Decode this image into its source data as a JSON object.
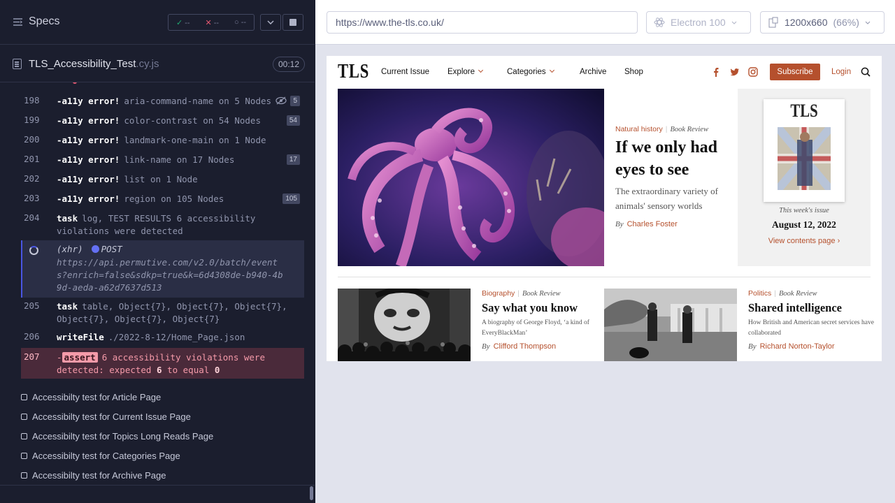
{
  "reporter": {
    "header": {
      "specs_label": "Specs",
      "passed": "--",
      "failed": "--",
      "pending": "--"
    },
    "spec": {
      "name": "TLS_Accessibility_Test",
      "ext": ".cy.js",
      "time": "00:12"
    },
    "commands": [
      {
        "num": "198",
        "kw": "-a11y error!",
        "msg": "aria-command-name on 5 Nodes",
        "badge": "5"
      },
      {
        "num": "199",
        "kw": "-a11y error!",
        "msg": "color-contrast on 54 Nodes",
        "badge": "54"
      },
      {
        "num": "200",
        "kw": "-a11y error!",
        "msg": "landmark-one-main on 1 Node",
        "badge": ""
      },
      {
        "num": "201",
        "kw": "-a11y error!",
        "msg": "link-name on 17 Nodes",
        "badge": "17"
      },
      {
        "num": "202",
        "kw": "-a11y error!",
        "msg": "list on 1 Node",
        "badge": ""
      },
      {
        "num": "203",
        "kw": "-a11y error!",
        "msg": "region on 105 Nodes",
        "badge": "105"
      },
      {
        "num": "204",
        "kw": "task",
        "msg": "log, TEST RESULTS 6 accessibility violations were detected",
        "badge": ""
      },
      {
        "num": "205",
        "kw": "task",
        "msg": "table, Object{7}, Object{7}, Object{7}, Object{7}, Object{7}, Object{7}",
        "badge": ""
      },
      {
        "num": "206",
        "kw": "writeFile",
        "msg": "./2022-8-12/Home_Page.json",
        "badge": ""
      }
    ],
    "xhr": {
      "label": "(xhr)",
      "method": "POST",
      "url": "https://api.permutive.com/v2.0/batch/events?enrich=false&sdkp=true&k=6d4308de-b940-4b9d-aeda-a62d7637d513"
    },
    "assert": {
      "num": "207",
      "dash": "-",
      "tag": "assert",
      "text1": "6 accessibility violations were detected: expected",
      "val1": "6",
      "text2": "to equal",
      "val2": "0"
    },
    "tests": [
      "Accessibilty test for Article Page",
      "Accessibilty test for Current Issue Page",
      "Accessibilty test for Topics Long Reads Page",
      "Accessibilty test for Categories Page",
      "Accessibilty test for Archive Page"
    ]
  },
  "aut": {
    "url": "https://www.the-tls.co.uk/",
    "browser": "Electron 100",
    "viewport": "1200x660",
    "zoom": "(66%)"
  },
  "tls": {
    "logo": "TLS",
    "nav": [
      "Current Issue",
      "Explore",
      "Categories",
      "Archive",
      "Shop"
    ],
    "subscribe": "Subscribe",
    "login": "Login",
    "hero": {
      "category": "Natural history",
      "type": "Book Review",
      "title": "If we only had eyes to see",
      "dek": "The extraordinary variety of animals' sensory worlds",
      "by": "By",
      "author": "Charles Foster"
    },
    "issue": {
      "cover_title": "TLS",
      "label": "This week's issue",
      "date": "August 12, 2022",
      "link": "View contents page"
    },
    "cards": [
      {
        "category": "Biography",
        "type": "Book Review",
        "title": "Say what you know",
        "dek": "A biography of George Floyd, ‘a kind of EveryBlackMan’",
        "by": "By",
        "author": "Clifford Thompson"
      },
      {
        "category": "Politics",
        "type": "Book Review",
        "title": "Shared intelligence",
        "dek": "How British and American secret services have collaborated",
        "by": "By",
        "author": "Richard Norton-Taylor"
      }
    ]
  },
  "colors": {
    "reporter_bg": "#1b1e2e",
    "accent_tls": "#b5502d",
    "assert_bg": "#4a2a3a",
    "xhr_bg": "#2a2e45"
  }
}
